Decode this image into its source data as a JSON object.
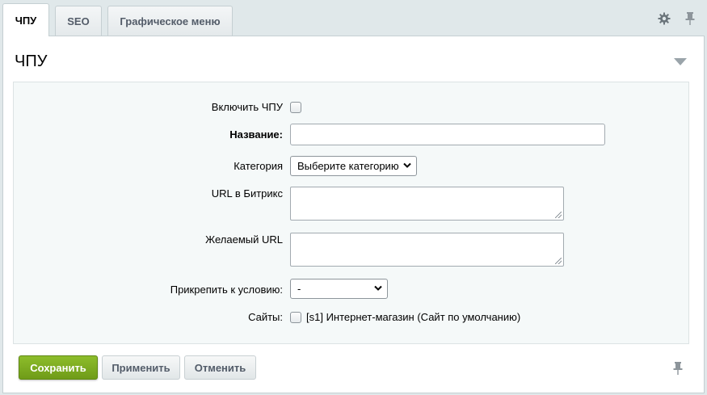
{
  "tabs": [
    {
      "label": "ЧПУ",
      "active": true
    },
    {
      "label": "SEO",
      "active": false
    },
    {
      "label": "Графическое меню",
      "active": false
    }
  ],
  "toolbar": {
    "settings_icon": "gear-icon",
    "pin_icon": "pin-icon"
  },
  "section": {
    "title": "ЧПУ"
  },
  "form": {
    "enable_label": "Включить ЧПУ",
    "enable_checked": false,
    "name_label": "Название:",
    "name_value": "",
    "category_label": "Категория",
    "category_selected": "Выберите категорию",
    "bitrix_url_label": "URL в Битрикс",
    "bitrix_url_value": "",
    "desired_url_label": "Желаемый URL",
    "desired_url_value": "",
    "condition_label": "Прикрепить к условию:",
    "condition_selected": "-",
    "sites_label": "Сайты:",
    "site_option": "[s1] Интернет-магазин (Сайт по умолчанию)",
    "site_checked": false
  },
  "buttons": {
    "save": "Сохранить",
    "apply": "Применить",
    "cancel": "Отменить"
  },
  "colors": {
    "accent_green": "#7aa91f",
    "panel_bg": "#ffffff",
    "form_bg": "#f5f9f9",
    "page_bg": "#e0e8ea"
  }
}
